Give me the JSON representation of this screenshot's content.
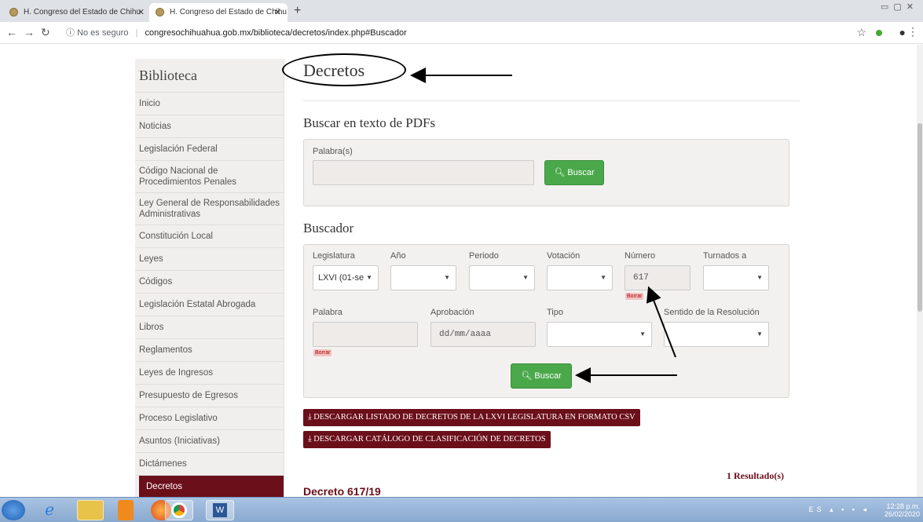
{
  "browser": {
    "tabs": [
      {
        "title": "H. Congreso del Estado de Chihu"
      },
      {
        "title": "H. Congreso del Estado de Chihu"
      }
    ],
    "new_tab": "+",
    "security": "No es seguro",
    "url": "congresochihuahua.gob.mx/biblioteca/decretos/index.php#Buscador"
  },
  "sidebar": {
    "title": "Biblioteca",
    "items": [
      {
        "label": "Inicio"
      },
      {
        "label": "Noticias"
      },
      {
        "label": "Legislación Federal"
      },
      {
        "label": "Código Nacional de Procedimientos Penales"
      },
      {
        "label": "Ley General de Responsabilidades Administrativas"
      },
      {
        "label": "Constitución Local"
      },
      {
        "label": "Leyes"
      },
      {
        "label": "Códigos"
      },
      {
        "label": "Legislación Estatal Abrogada"
      },
      {
        "label": "Libros"
      },
      {
        "label": "Reglamentos"
      },
      {
        "label": "Leyes de Ingresos"
      },
      {
        "label": "Presupuesto de Egresos"
      },
      {
        "label": "Proceso Legislativo"
      },
      {
        "label": "Asuntos (Iniciativas)"
      },
      {
        "label": "Dictámenes"
      },
      {
        "label": "Decretos"
      }
    ]
  },
  "main": {
    "title": "Decretos",
    "pdf_search": {
      "heading": "Buscar en texto de PDFs",
      "word_label": "Palabra(s)",
      "word_value": "",
      "button": "Buscar"
    },
    "buscador": {
      "heading": "Buscador",
      "legislatura_label": "Legislatura",
      "legislatura_value": "LXVI (01-se",
      "anio_label": "Año",
      "periodo_label": "Periodo",
      "votacion_label": "Votación",
      "numero_label": "Número",
      "numero_value": "617",
      "turnados_label": "Turnados a",
      "palabra_label": "Palabra",
      "aprobacion_label": "Aprobación",
      "aprobacion_placeholder": "dd/mm/aaaa",
      "tipo_label": "Tipo",
      "sentido_label": "Sentido de la Resolución",
      "borrar": "Borrar",
      "button": "Buscar"
    },
    "download_csv": "DESCARGAR LISTADO DE DECRETOS DE LA LXVI LEGISLATURA EN FORMATO CSV",
    "download_catalog": "DESCARGAR CATÁLOGO DE CLASIFICACIÓN DE DECRETOS",
    "results_count": "1 Resultado(s)",
    "result_title": "Decreto 617/19"
  },
  "taskbar": {
    "lang": "ES",
    "time": "12:28 p.m.",
    "date": "26/02/2020"
  }
}
